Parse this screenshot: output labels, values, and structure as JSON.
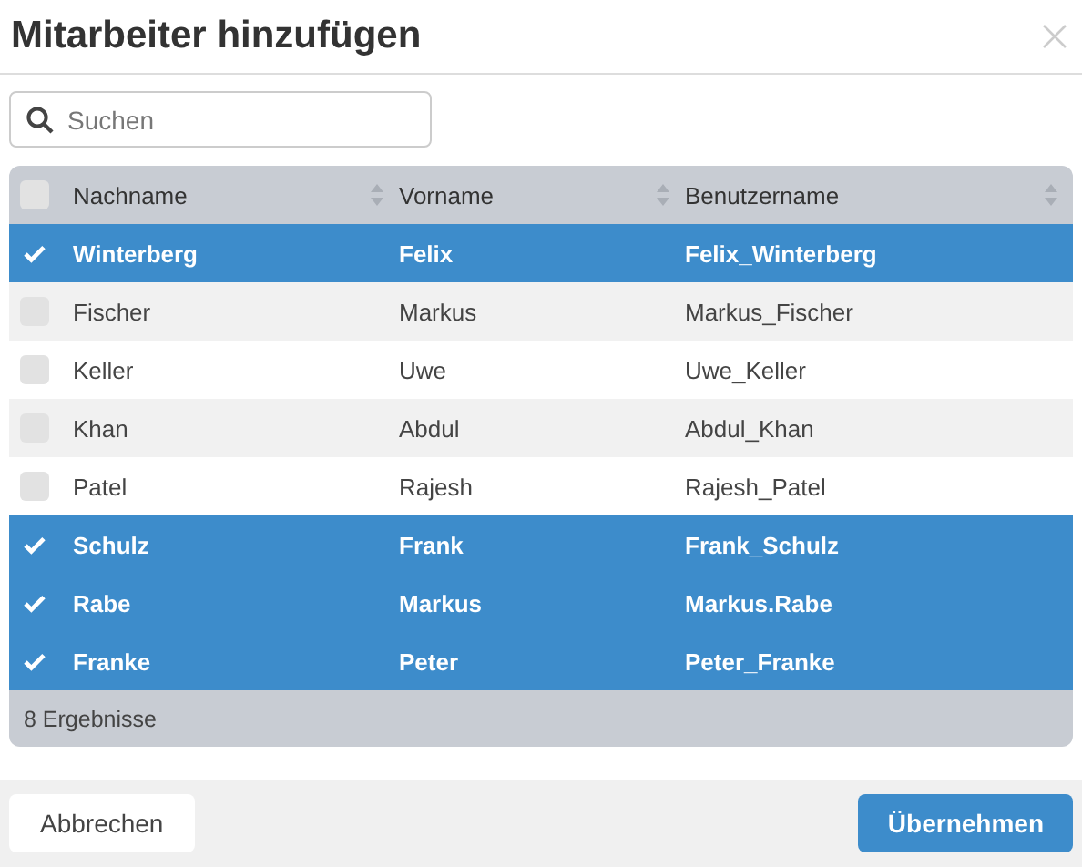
{
  "dialog": {
    "title": "Mitarbeiter hinzufügen"
  },
  "search": {
    "placeholder": "Suchen"
  },
  "table": {
    "select_all": {
      "checked": false
    },
    "columns": [
      "Nachname",
      "Vorname",
      "Benutzername"
    ],
    "rows": [
      {
        "cells": [
          "Winterberg",
          "Felix",
          "Felix_Winterberg"
        ],
        "selected": true
      },
      {
        "cells": [
          "Fischer",
          "Markus",
          "Markus_Fischer"
        ],
        "selected": false
      },
      {
        "cells": [
          "Keller",
          "Uwe",
          "Uwe_Keller"
        ],
        "selected": false
      },
      {
        "cells": [
          "Khan",
          "Abdul",
          "Abdul_Khan"
        ],
        "selected": false
      },
      {
        "cells": [
          "Patel",
          "Rajesh",
          "Rajesh_Patel"
        ],
        "selected": false
      },
      {
        "cells": [
          "Schulz",
          "Frank",
          "Frank_Schulz"
        ],
        "selected": true
      },
      {
        "cells": [
          "Rabe",
          "Markus",
          "Markus.Rabe"
        ],
        "selected": true
      },
      {
        "cells": [
          "Franke",
          "Peter",
          "Peter_Franke"
        ],
        "selected": true
      }
    ],
    "footer": "8 Ergebnisse"
  },
  "buttons": [
    {
      "label": "Abbrechen",
      "kind": "secondary"
    },
    {
      "label": "Übernehmen",
      "kind": "primary"
    }
  ]
}
